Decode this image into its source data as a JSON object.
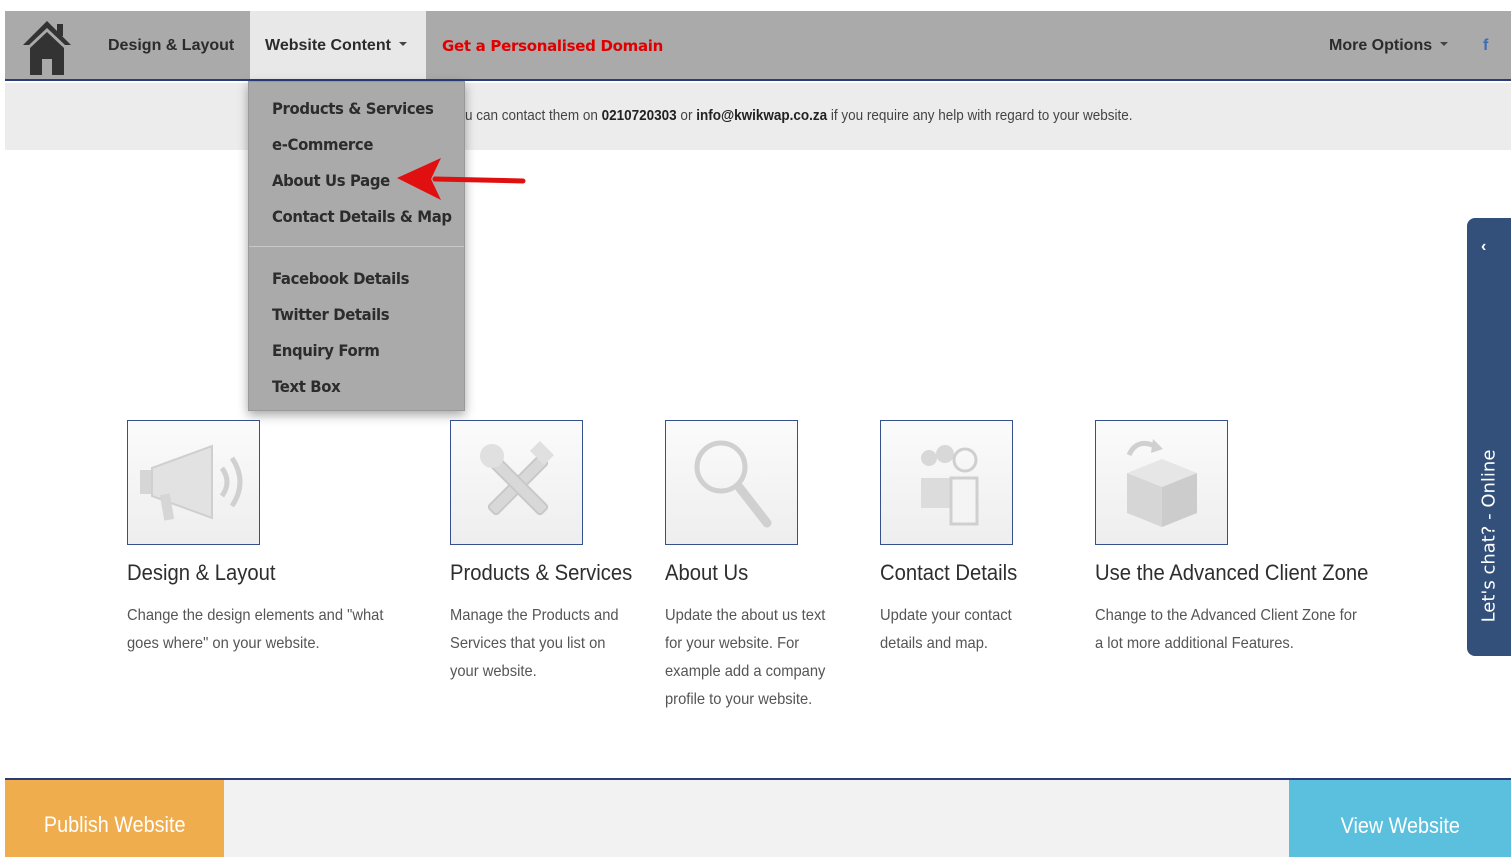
{
  "navbar": {
    "home_icon": "home-icon",
    "design_label": "Design & Layout",
    "content_label": "Website Content",
    "domain_label": "Get a Personalised Domain",
    "more_label": "More Options",
    "facebook_icon": "f"
  },
  "info": {
    "prefix": "u can contact them on ",
    "phone": "0210720303",
    "mid": " or ",
    "email": "info@kwikwap.co.za",
    "suffix": " if you require any help with regard to your website."
  },
  "dropdown": {
    "items": [
      "Products & Services",
      "e-Commerce",
      "About Us Page",
      "Contact Details & Map",
      "Facebook Details",
      "Twitter Details",
      "Enquiry Form",
      "Text Box"
    ]
  },
  "features": [
    {
      "icon": "megaphone-icon",
      "title": "Design & Layout",
      "desc": [
        "Change the design elements and \"what",
        "goes where\" on your website."
      ]
    },
    {
      "icon": "tools-icon",
      "title": "Products & Services",
      "desc": [
        "Manage the Products and",
        "Services that you list on",
        "your website."
      ]
    },
    {
      "icon": "magnifier-icon",
      "title": "About Us",
      "desc": [
        "Update the about us text",
        "for your website. For",
        "example add a company",
        "profile to your website."
      ]
    },
    {
      "icon": "people-icon",
      "title": "Contact Details",
      "desc": [
        "Update your contact",
        "details and map."
      ]
    },
    {
      "icon": "box-icon",
      "title": "Use the Advanced Client Zone",
      "desc": [
        "Change to the Advanced Client Zone for",
        "a lot more additional Features."
      ]
    }
  ],
  "chat": {
    "label": "Let's chat? - Online",
    "chevron": "‹"
  },
  "footer": {
    "publish_label": "Publish Website",
    "view_label": "View Website"
  },
  "colors": {
    "navbar": "#aaaaaa",
    "domain_red": "#e00000",
    "publish_orange": "#f0ad4e",
    "view_blue": "#5bc0de",
    "chat_blue": "#33507a"
  }
}
